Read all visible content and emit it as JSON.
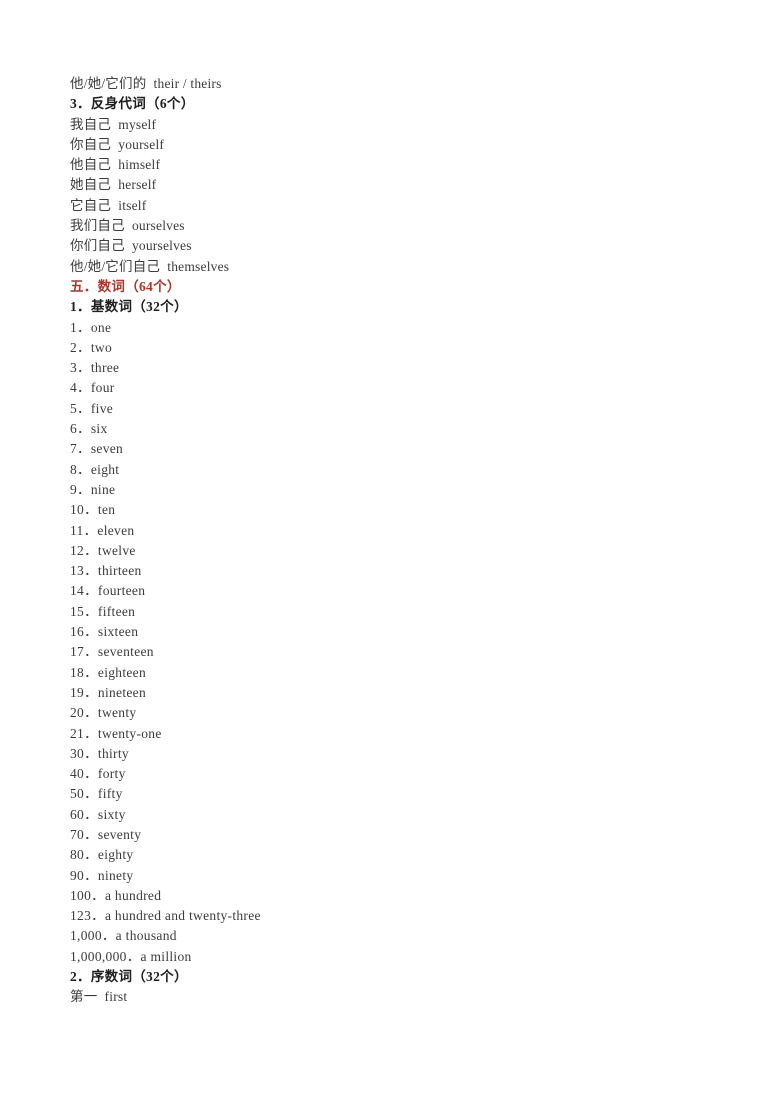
{
  "document": {
    "page_background": "#ffffff",
    "body_text_color": "#3c3c3c",
    "heading_color": "#1e1e1e",
    "accent_color": "#a4392d"
  },
  "blocks": [
    {
      "type": "entry",
      "text": "他/她/它们的  their / theirs"
    },
    {
      "type": "heading",
      "style": "black",
      "text": "3．反身代词（6个）"
    },
    {
      "type": "entry",
      "text": "我自己  myself"
    },
    {
      "type": "entry",
      "text": "你自己  yourself"
    },
    {
      "type": "entry",
      "text": "他自己  himself"
    },
    {
      "type": "entry",
      "text": "她自己  herself"
    },
    {
      "type": "entry",
      "text": "它自己  itself"
    },
    {
      "type": "entry",
      "text": "我们自己  ourselves"
    },
    {
      "type": "entry",
      "text": "你们自己  yourselves"
    },
    {
      "type": "entry",
      "text": "他/她/它们自己  themselves"
    },
    {
      "type": "heading",
      "style": "red",
      "text": "五．数词（64个）"
    },
    {
      "type": "heading",
      "style": "black",
      "text": "1．基数词（32个）"
    },
    {
      "type": "number",
      "text": "1．one"
    },
    {
      "type": "number",
      "text": "2．two"
    },
    {
      "type": "number",
      "text": "3．three"
    },
    {
      "type": "number",
      "text": "4．four"
    },
    {
      "type": "number",
      "text": "5．five"
    },
    {
      "type": "number",
      "text": "6．six"
    },
    {
      "type": "number",
      "text": "7．seven"
    },
    {
      "type": "number",
      "text": "8．eight"
    },
    {
      "type": "number",
      "text": "9．nine"
    },
    {
      "type": "number",
      "text": "10．ten"
    },
    {
      "type": "number",
      "text": "11．eleven"
    },
    {
      "type": "number",
      "text": "12．twelve"
    },
    {
      "type": "number",
      "text": "13．thirteen"
    },
    {
      "type": "number",
      "text": "14．fourteen"
    },
    {
      "type": "number",
      "text": "15．fifteen"
    },
    {
      "type": "number",
      "text": "16．sixteen"
    },
    {
      "type": "number",
      "text": "17．seventeen"
    },
    {
      "type": "number",
      "text": "18．eighteen"
    },
    {
      "type": "number",
      "text": "19．nineteen"
    },
    {
      "type": "number",
      "text": "20．twenty"
    },
    {
      "type": "number",
      "text": "21．twenty-one"
    },
    {
      "type": "number",
      "text": "30．thirty"
    },
    {
      "type": "number",
      "text": "40．forty"
    },
    {
      "type": "number",
      "text": "50．fifty"
    },
    {
      "type": "number",
      "text": "60．sixty"
    },
    {
      "type": "number",
      "text": "70．seventy"
    },
    {
      "type": "number",
      "text": "80．eighty"
    },
    {
      "type": "number",
      "text": "90．ninety"
    },
    {
      "type": "number",
      "text": "100．a hundred"
    },
    {
      "type": "number",
      "text": "123．a hundred and twenty-three"
    },
    {
      "type": "number",
      "text": "1,000．a thousand"
    },
    {
      "type": "number",
      "text": "1,000,000．a million"
    },
    {
      "type": "heading",
      "style": "black",
      "text": "2．序数词（32个）"
    },
    {
      "type": "entry",
      "text": "第一  first"
    }
  ]
}
